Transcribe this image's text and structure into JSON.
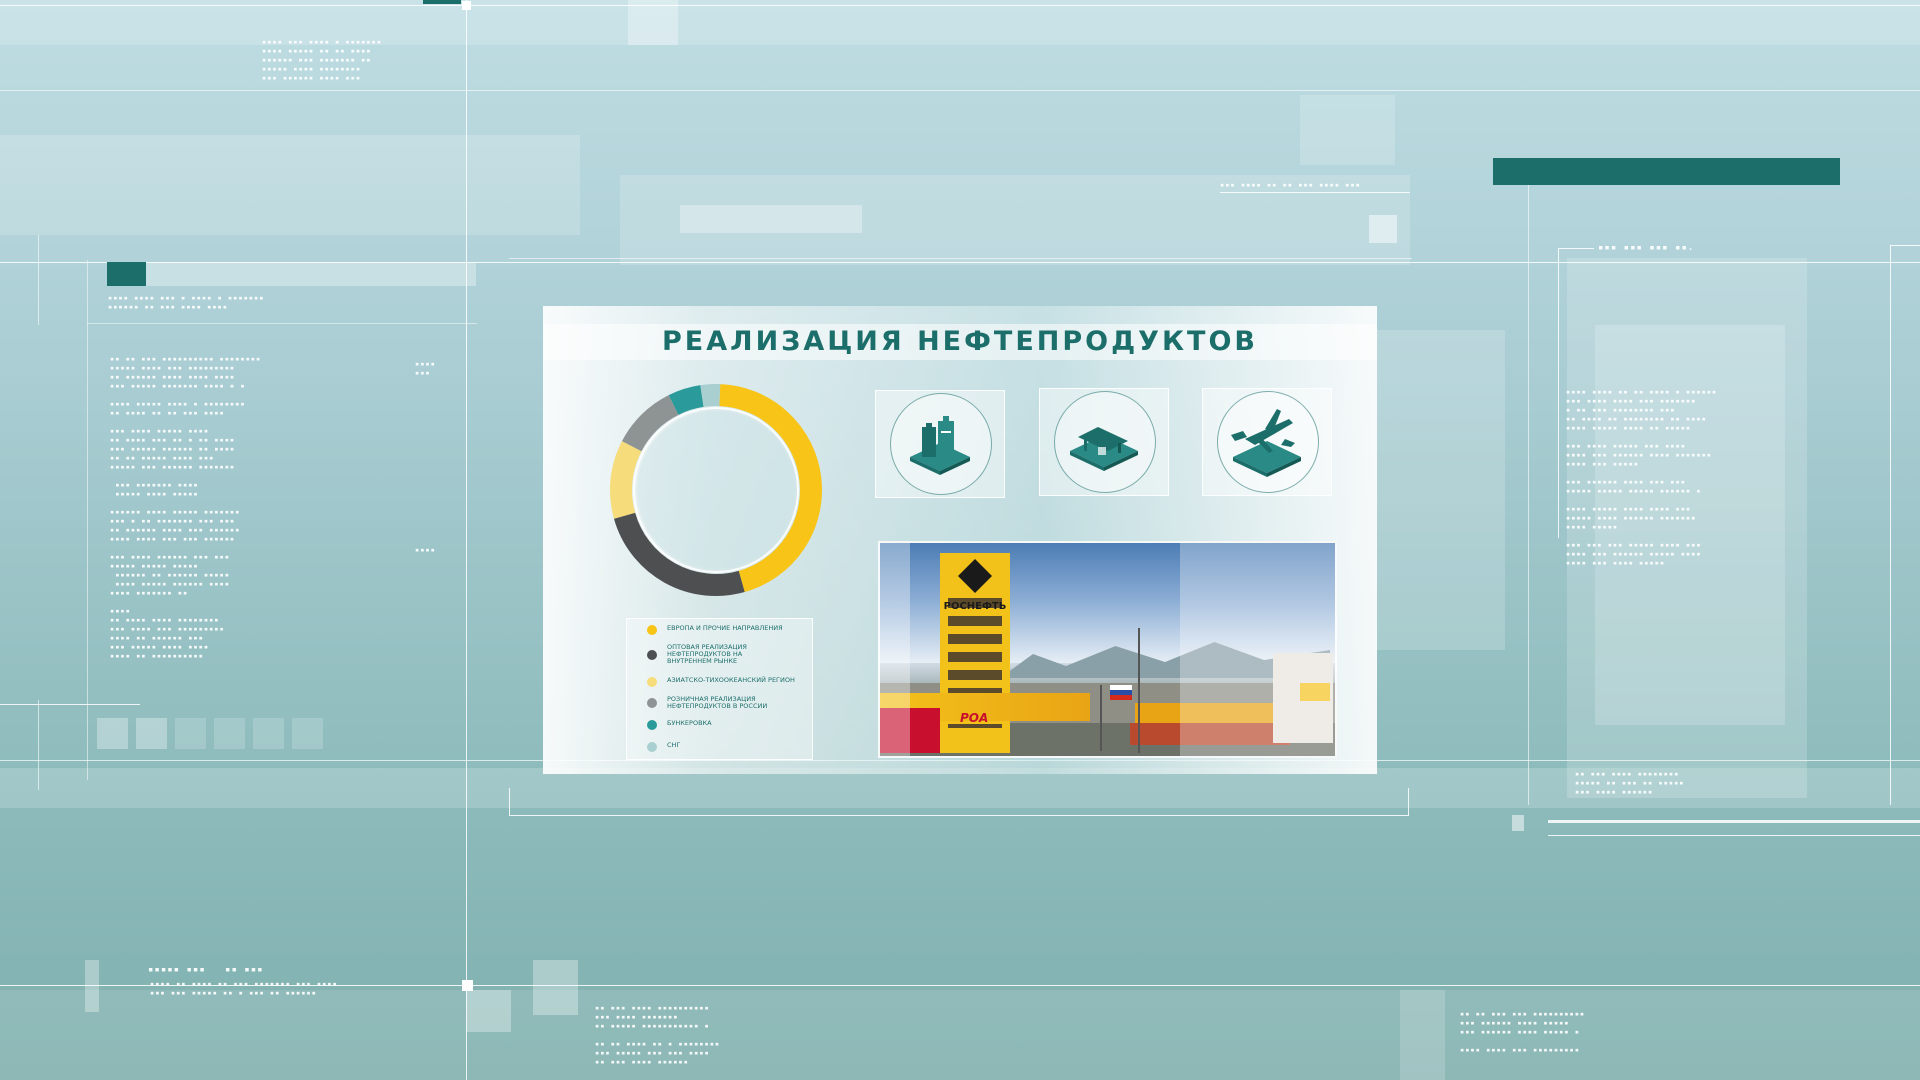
{
  "title": "РЕАЛИЗАЦИЯ НЕФТЕПРОДУКТОВ",
  "colors": {
    "accent": "#1c6e6b",
    "yellow": "#f7c417",
    "dark": "#4d4f50",
    "light_yellow": "#f6dc7a",
    "gray": "#8e9394",
    "teal": "#2a9a9a",
    "pale_teal": "#a9cfd0"
  },
  "icons": [
    "oil-canisters-icon",
    "gas-station-icon",
    "airplane-bunkering-icon"
  ],
  "photo": {
    "brand_text": "РОСНЕФТЬ",
    "brand_text_short": "РОА"
  },
  "chart_data": {
    "type": "pie",
    "style": "donut",
    "segments": [
      {
        "label": "ЕВРОПА И ПРОЧИЕ НАПРАВЛЕНИЯ",
        "value": 45,
        "color": "#f7c417"
      },
      {
        "label": "ОПТОВАЯ РЕАЛИЗАЦИЯ НЕФТЕПРОДУКТОВ НА ВНУТРЕННЕМ РЫНКЕ",
        "value": 25,
        "color": "#4d4f50"
      },
      {
        "label": "АЗИАТСКО-ТИХООКЕАНСКИЙ РЕГИОН",
        "value": 12,
        "color": "#f6dc7a"
      },
      {
        "label": "РОЗНИЧНАЯ РЕАЛИЗАЦИЯ НЕФТЕПРОДУКТОВ В РОССИИ",
        "value": 10,
        "color": "#8e9394"
      },
      {
        "label": "БУНКЕРОВКА",
        "value": 5,
        "color": "#2a9a9a"
      },
      {
        "label": "СНГ",
        "value": 3,
        "color": "#a9cfd0"
      }
    ]
  },
  "legend": {
    "items": [
      {
        "label": "ЕВРОПА И ПРОЧИЕ НАПРАВЛЕНИЯ",
        "color": "#f7c417"
      },
      {
        "label": "ОПТОВАЯ РЕАЛИЗАЦИЯ НЕФТЕПРОДУКТОВ НА ВНУТРЕННЕМ РЫНКЕ",
        "color": "#4d4f50"
      },
      {
        "label": "АЗИАТСКО-ТИХООКЕАНСКИЙ РЕГИОН",
        "color": "#f6dc7a"
      },
      {
        "label": "РОЗНИЧНАЯ РЕАЛИЗАЦИЯ НЕФТЕПРОДУКТОВ В РОССИИ",
        "color": "#8e9394"
      },
      {
        "label": "БУНКЕРОВКА",
        "color": "#2a9a9a"
      },
      {
        "label": "СНГ",
        "color": "#a9cfd0"
      }
    ]
  }
}
